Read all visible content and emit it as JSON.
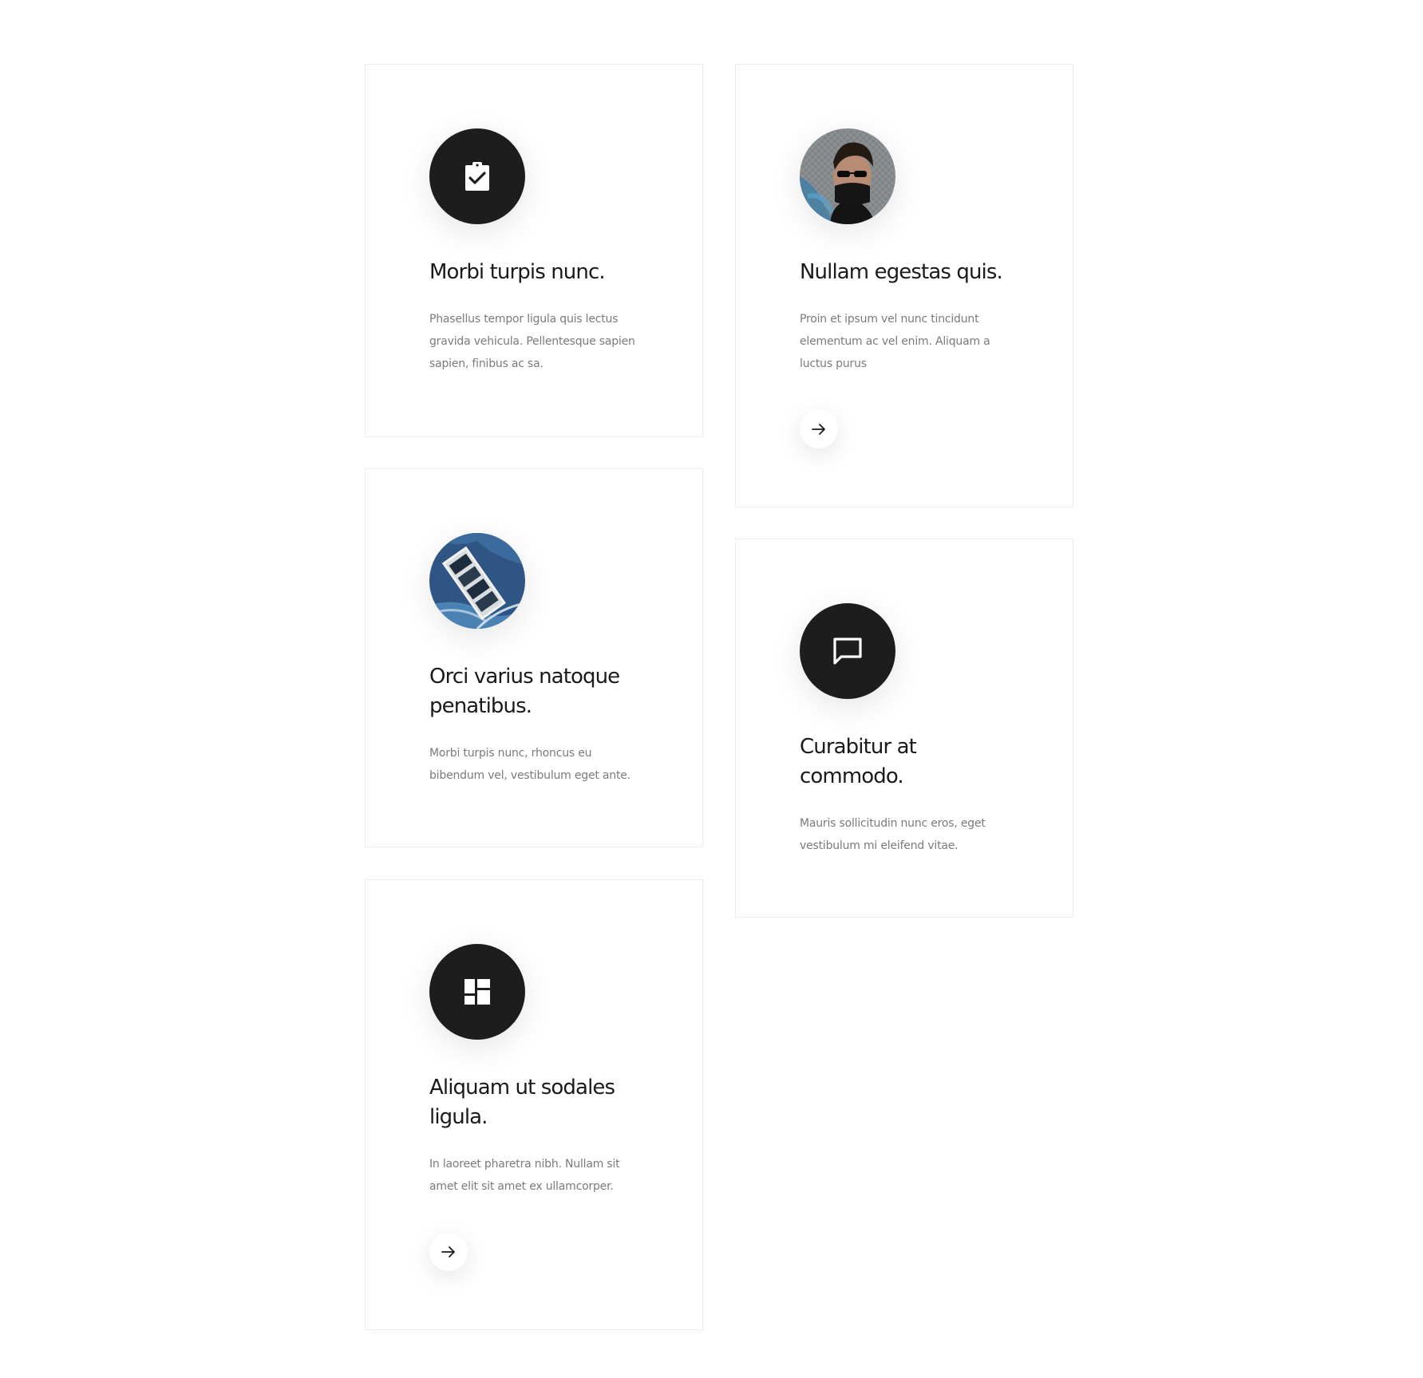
{
  "cards": [
    {
      "title": "Morbi turpis nunc.",
      "text": "Phasellus tempor ligula quis lectus gravida vehicula. Pellentesque sapien sapien, finibus ac sa.",
      "icon": "clipboard-check-icon"
    },
    {
      "title": "Nullam egestas quis.",
      "text": "Proin et ipsum vel nunc tincidunt elementum ac vel enim. Aliquam a luctus purus",
      "icon": "person-photo"
    },
    {
      "title": "Orci varius natoque penatibus.",
      "text": "Morbi turpis nunc, rhoncus eu bibendum vel, vestibulum eget ante.",
      "icon": "aerial-photo"
    },
    {
      "title": "Curabitur at commodo.",
      "text": "Mauris sollicitudin nunc eros, eget vestibulum mi eleifend vitae.",
      "icon": "chat-bubble-icon"
    },
    {
      "title": "Aliquam ut sodales ligula.",
      "text": "In laoreet pharetra nibh. Nullam sit amet elit sit amet ex ullamcorper.",
      "icon": "dashboard-icon"
    }
  ],
  "colors": {
    "icon_bg": "#1d1d1d",
    "title": "#1a1a1a",
    "text": "#7b7b7b",
    "border": "#ececec"
  }
}
